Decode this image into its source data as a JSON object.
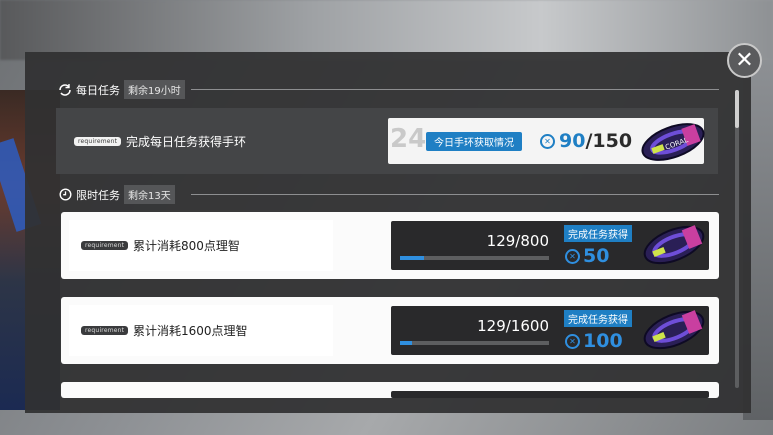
{
  "close": {
    "glyph": "✕"
  },
  "daily": {
    "title": "每日任务",
    "remaining": "剩余19小时",
    "task": {
      "tag": "requirement",
      "text": "完成每日任务获得手环",
      "big_number": "24",
      "progress_label": "今日手环获取情况",
      "current": "90",
      "max": "/150"
    }
  },
  "limited": {
    "title": "限时任务",
    "remaining": "剩余13天",
    "reward_label": "完成任务获得",
    "tasks": [
      {
        "tag": "requirement",
        "text": "累计消耗800点理智",
        "progress": "129/800",
        "fill_fraction": 0.161,
        "reward": "50"
      },
      {
        "tag": "requirement",
        "text": "累计消耗1600点理智",
        "progress": "129/1600",
        "fill_fraction": 0.081,
        "reward": "100"
      }
    ]
  },
  "colors": {
    "accent": "#1f7fc4",
    "panel": "#303032",
    "card": "#fbfbfb"
  },
  "icons": [
    "refresh-icon",
    "clock-icon",
    "wristband-token-icon",
    "wristband-item-icon",
    "close-icon"
  ]
}
